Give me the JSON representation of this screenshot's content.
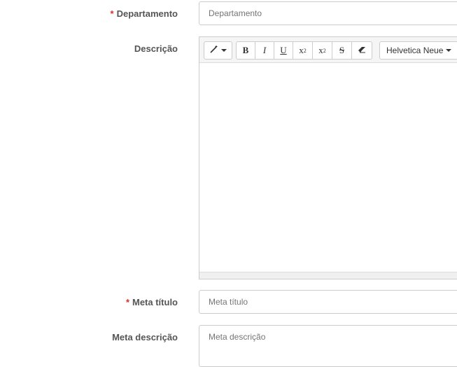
{
  "fields": {
    "department": {
      "label": "Departamento",
      "required_mark": "*",
      "placeholder": "Departamento"
    },
    "description": {
      "label": "Descrição"
    },
    "meta_title": {
      "label": "Meta título",
      "required_mark": "*",
      "placeholder": "Meta título"
    },
    "meta_description": {
      "label": "Meta descrição",
      "placeholder": "Meta descrição"
    }
  },
  "editor": {
    "toolbar": {
      "style_icon": "magic-wand-icon",
      "bold": "B",
      "italic": "I",
      "underline": "U",
      "superscript_base": "x",
      "superscript_exp": "2",
      "subscript_base": "x",
      "subscript_sub": "2",
      "strikethrough": "S",
      "eraser_icon": "eraser-icon",
      "font_name": "Helvetica Neue"
    },
    "content": ""
  },
  "colors": {
    "required": "#d9302c",
    "label": "#555555",
    "border": "#cccccc",
    "placeholder": "#999999"
  }
}
